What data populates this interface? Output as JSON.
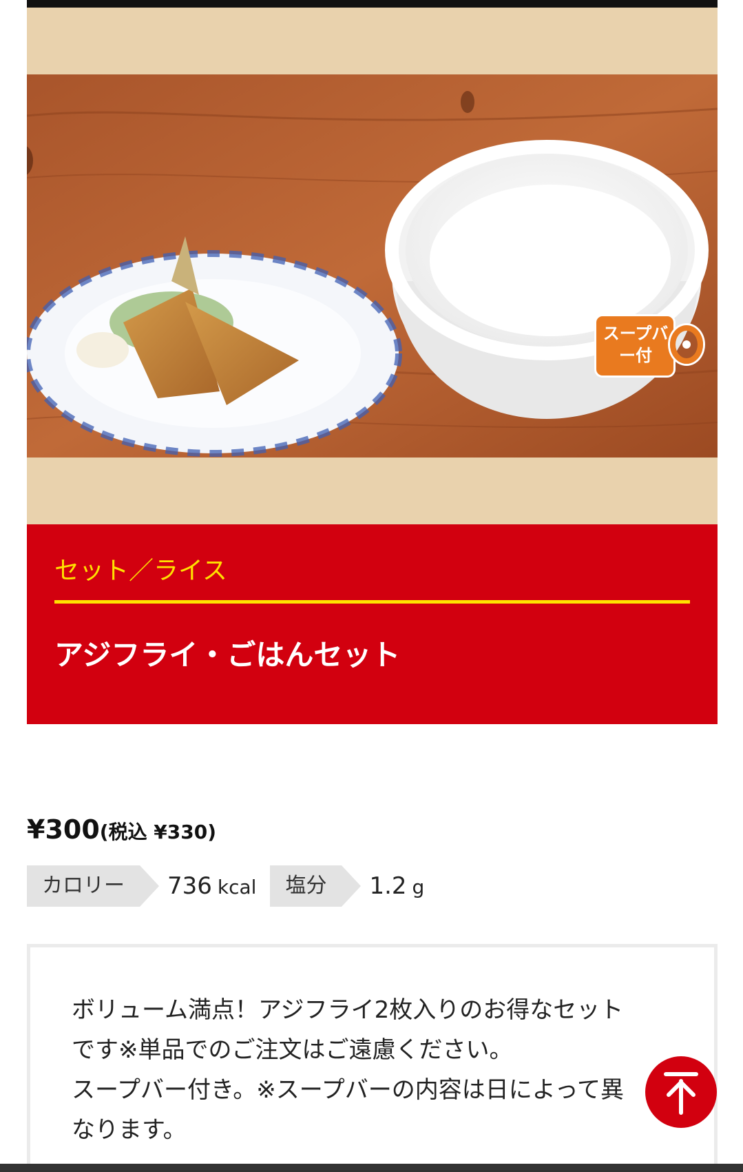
{
  "hero": {
    "image_alt": "アジフライ・ごはんセット",
    "badge_label": "スープバー付"
  },
  "title_panel": {
    "category": "セット／ライス",
    "product_name": "アジフライ・ごはんセット"
  },
  "price": {
    "main": "¥300",
    "tax_included": "(税込 ¥330)"
  },
  "nutrition": {
    "calorie_label": "カロリー",
    "calorie_value": "736",
    "calorie_unit": "kcal",
    "salt_label": "塩分",
    "salt_value": "1.2",
    "salt_unit": "g"
  },
  "description": {
    "text": "ボリューム満点！アジフライ2枚入りのお得なセット\nです※単品でのご注文はご遠慮ください。\nスープバー付き。※スープバーの内容は日によって異\nなります。"
  },
  "back_to_top": {
    "icon": "arrow-up-to-line-icon",
    "color": "#d2000f"
  },
  "colors": {
    "brand_red": "#d2000f",
    "accent_yellow": "#ffe100",
    "hero_beige": "#e9d2ad",
    "badge_orange": "#e97a1f"
  }
}
